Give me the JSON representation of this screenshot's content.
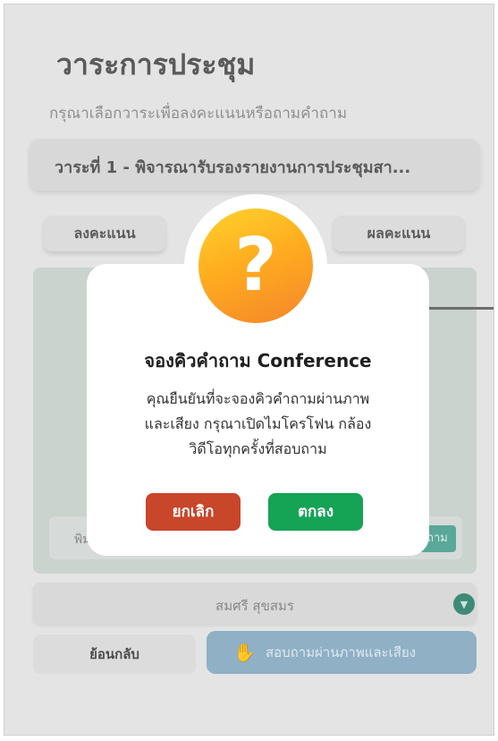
{
  "page": {
    "title": "วาระการประชุม",
    "subtitle": "กรุณาเลือกวาระเพื่อลงคะแนนหรือถามคำถาม",
    "agenda_selected": "วาระที่ 1 - พิจารณารับรองรายงานการประชุมสา..."
  },
  "tabs": {
    "vote": "ลงคะแนน",
    "results": "ผลคะแนน"
  },
  "question": {
    "input_placeholder": "พิม",
    "send_label": "ถาม"
  },
  "user": {
    "name": "สมศรี สุขสมร"
  },
  "footer": {
    "back": "ย้อนกลับ",
    "av_question": "สอบถามผ่านภาพและเสียง"
  },
  "modal": {
    "icon": "question-icon",
    "title": "จองคิวคำถาม Conference",
    "body_lines": [
      "คุณยืนยันที่จะจองคิวคำถามผ่านภาพ",
      "และเสียง กรุณาเปิดไมโครโฟน กล้อง",
      "วิดีโอทุกครั้งที่สอบถาม"
    ],
    "cancel": "ยกเลิก",
    "confirm": "ตกลง"
  },
  "colors": {
    "cancel": "#c8462a",
    "confirm": "#15a355",
    "badge": "#f9a825",
    "av_button": "#8fb0c5"
  }
}
